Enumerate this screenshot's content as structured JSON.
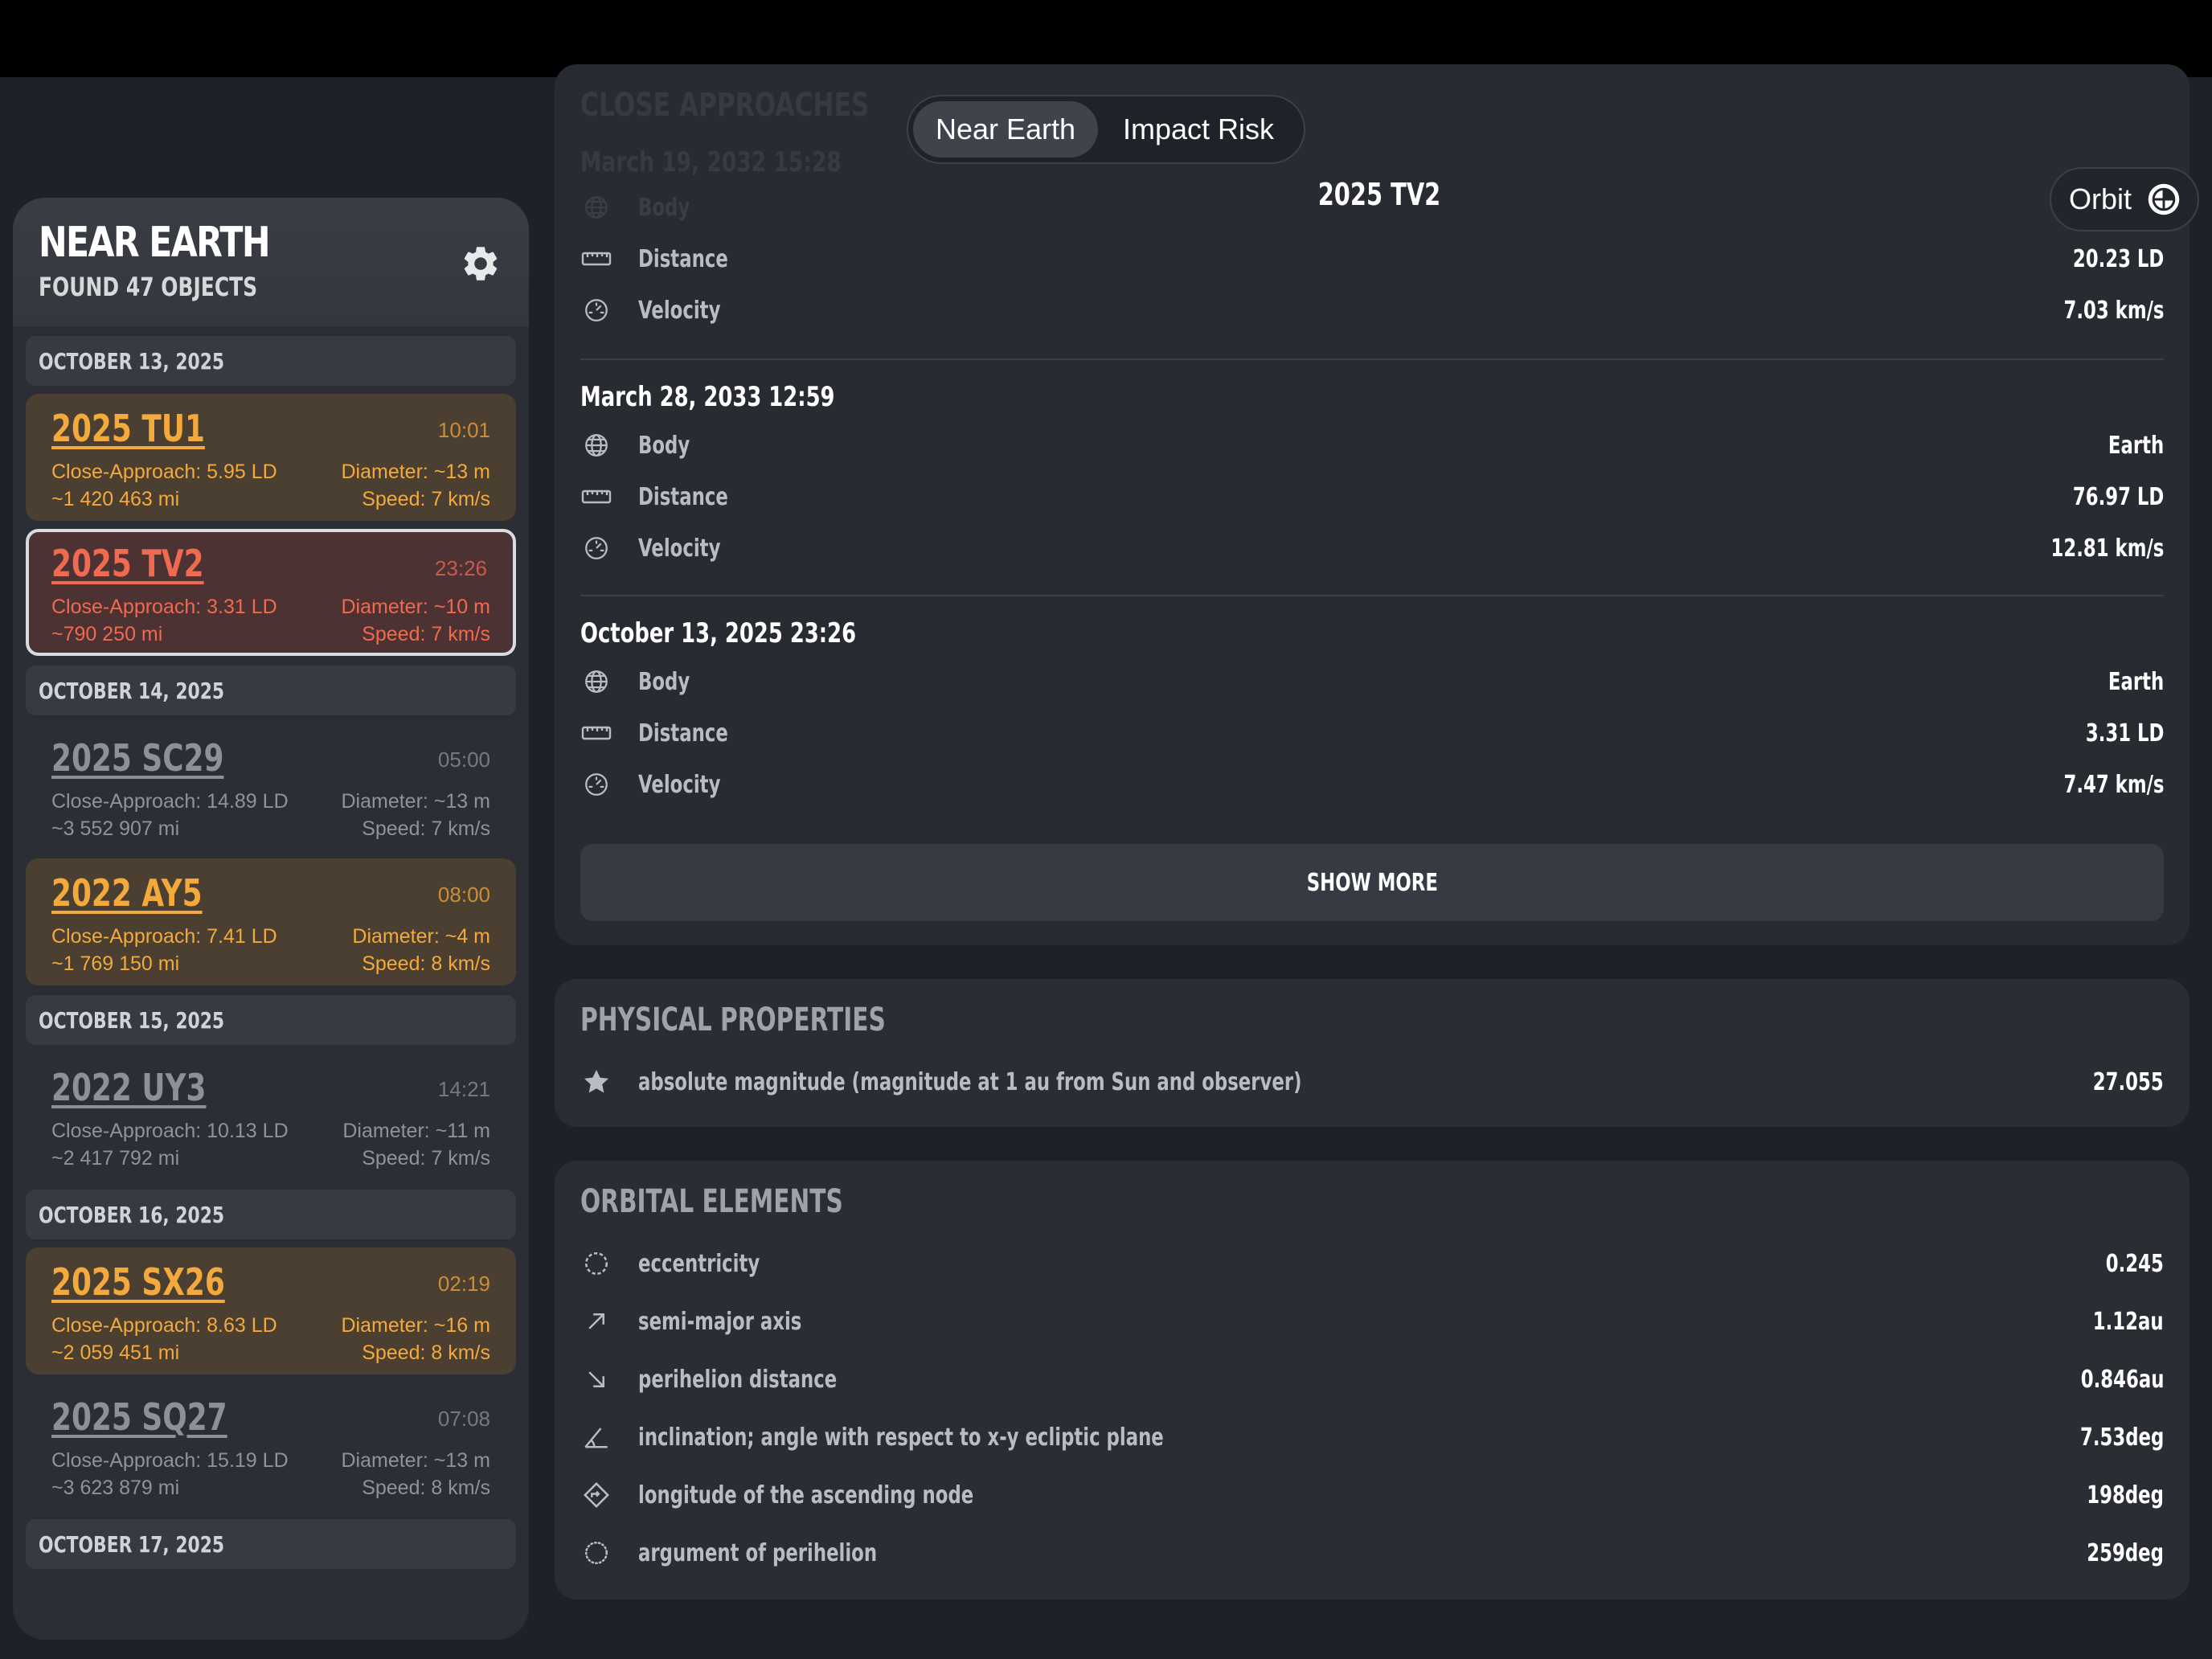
{
  "sidebar": {
    "title": "NEAR EARTH",
    "subtitle": "FOUND 47 OBJECTS",
    "icons": {
      "settings": "gear-icon"
    },
    "sections": [
      {
        "date": "OCTOBER 13, 2025",
        "items": [
          {
            "name": "2025 TU1",
            "time": "10:01",
            "approach": "Close-Approach: 5.95 LD",
            "miles": "~1 420 463 mi",
            "diameter": "Diameter: ~13 m",
            "speed": "Speed: 7 km/s",
            "style": "orange"
          },
          {
            "name": "2025 TV2",
            "time": "23:26",
            "approach": "Close-Approach: 3.31 LD",
            "miles": "~790 250 mi",
            "diameter": "Diameter: ~10 m",
            "speed": "Speed: 7 km/s",
            "style": "red"
          }
        ]
      },
      {
        "date": "OCTOBER 14, 2025",
        "items": [
          {
            "name": "2025 SC29",
            "time": "05:00",
            "approach": "Close-Approach: 14.89 LD",
            "miles": "~3 552 907 mi",
            "diameter": "Diameter: ~13 m",
            "speed": "Speed: 7 km/s",
            "style": "gray"
          },
          {
            "name": "2022 AY5",
            "time": "08:00",
            "approach": "Close-Approach: 7.41 LD",
            "miles": "~1 769 150 mi",
            "diameter": "Diameter: ~4 m",
            "speed": "Speed: 8 km/s",
            "style": "orange"
          }
        ]
      },
      {
        "date": "OCTOBER 15, 2025",
        "items": [
          {
            "name": "2022 UY3",
            "time": "14:21",
            "approach": "Close-Approach: 10.13 LD",
            "miles": "~2 417 792 mi",
            "diameter": "Diameter: ~11 m",
            "speed": "Speed: 7 km/s",
            "style": "gray"
          }
        ]
      },
      {
        "date": "OCTOBER 16, 2025",
        "items": [
          {
            "name": "2025 SX26",
            "time": "02:19",
            "approach": "Close-Approach: 8.63 LD",
            "miles": "~2 059 451 mi",
            "diameter": "Diameter: ~16 m",
            "speed": "Speed: 8 km/s",
            "style": "orange"
          },
          {
            "name": "2025 SQ27",
            "time": "07:08",
            "approach": "Close-Approach: 15.19 LD",
            "miles": "~3 623 879 mi",
            "diameter": "Diameter: ~13 m",
            "speed": "Speed: 8 km/s",
            "style": "gray"
          }
        ]
      },
      {
        "date": "OCTOBER 17, 2025",
        "items": []
      }
    ]
  },
  "segmented": {
    "near_earth": "Near Earth",
    "impact_risk": "Impact Risk",
    "selected": "Near Earth"
  },
  "object_title": "2025 TV2",
  "orbit_button": {
    "label": "Orbit",
    "icon": "globe-icon"
  },
  "close_approaches": {
    "section_title": "CLOSE APPROACHES",
    "first_date_partial": "March 19, 2032 15:28",
    "partial_rows": [
      {
        "label": "Body",
        "value": "",
        "icon": "globe-icon"
      },
      {
        "label": "Distance",
        "value": "20.23 LD",
        "icon": "ruler-icon"
      },
      {
        "label": "Velocity",
        "value": "7.03 km/s",
        "icon": "speedometer-icon"
      }
    ],
    "groups": [
      {
        "date": "March 28, 2033 12:59",
        "rows": [
          {
            "label": "Body",
            "value": "Earth",
            "icon": "globe-icon"
          },
          {
            "label": "Distance",
            "value": "76.97 LD",
            "icon": "ruler-icon"
          },
          {
            "label": "Velocity",
            "value": "12.81 km/s",
            "icon": "speedometer-icon"
          }
        ]
      },
      {
        "date": "October 13, 2025 23:26",
        "rows": [
          {
            "label": "Body",
            "value": "Earth",
            "icon": "globe-icon"
          },
          {
            "label": "Distance",
            "value": "3.31 LD",
            "icon": "ruler-icon"
          },
          {
            "label": "Velocity",
            "value": "7.47 km/s",
            "icon": "speedometer-icon"
          }
        ]
      }
    ],
    "show_more": "SHOW MORE"
  },
  "physical": {
    "title": "PHYSICAL PROPERTIES",
    "rows": [
      {
        "label": "absolute magnitude (magnitude at 1 au from Sun and observer)",
        "value": "27.055",
        "icon": "star-icon"
      }
    ]
  },
  "orbital": {
    "title": "ORBITAL ELEMENTS",
    "rows": [
      {
        "label": "eccentricity",
        "value": "0.245",
        "icon": "dashed-circle-icon"
      },
      {
        "label": "semi-major axis",
        "value": "1.12au",
        "icon": "arrow-up-right-icon"
      },
      {
        "label": "perihelion distance",
        "value": "0.846au",
        "icon": "arrow-down-right-icon"
      },
      {
        "label": "inclination; angle with respect to x-y ecliptic plane",
        "value": "7.53deg",
        "icon": "angle-icon"
      },
      {
        "label": "longitude of the ascending node",
        "value": "198deg",
        "icon": "diamond-arrow-icon"
      },
      {
        "label": "argument of perihelion",
        "value": "259deg",
        "icon": "dotted-circle-icon"
      }
    ]
  },
  "colors": {
    "background": "#1e2128",
    "card": "#2a2d34",
    "orange": "#f4a93c",
    "red": "#ef6a4f",
    "gray": "#8e939b"
  }
}
